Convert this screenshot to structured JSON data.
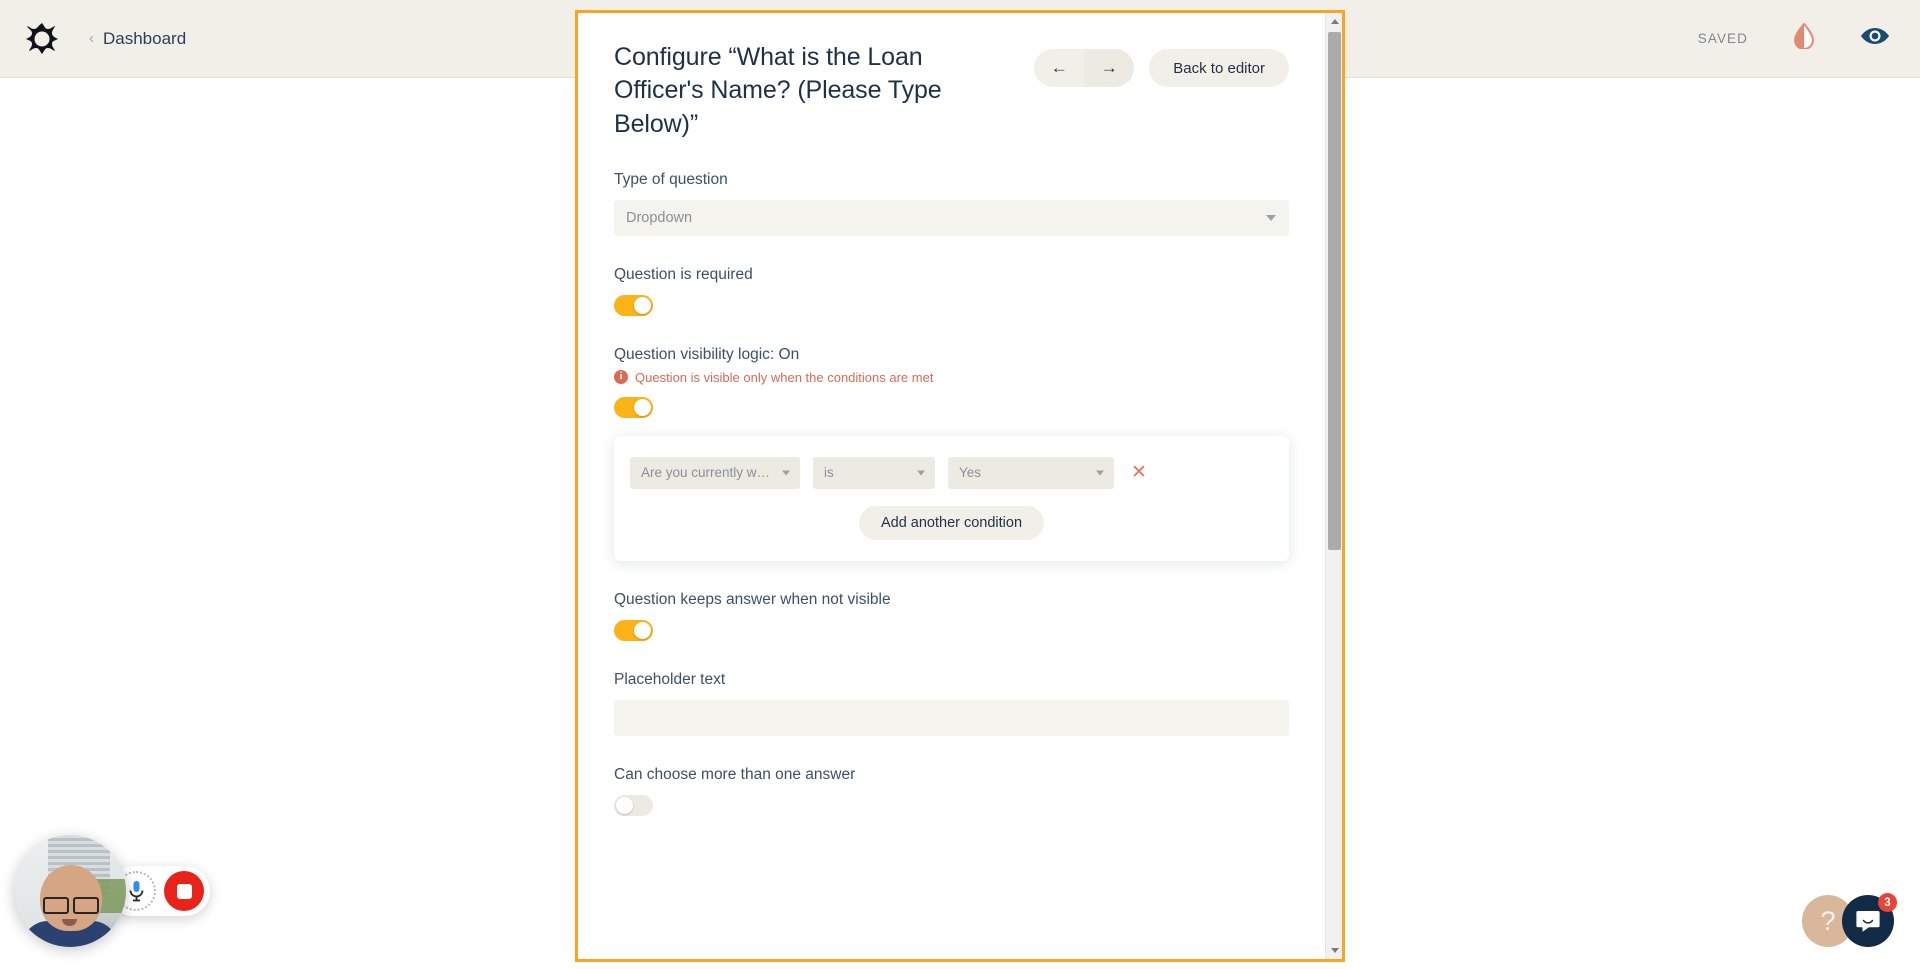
{
  "topbar": {
    "logo_icon": "flower-logo-icon",
    "breadcrumb_chevron": "‹",
    "breadcrumb_label": "Dashboard",
    "saved_label": "SAVED",
    "contrast_icon": "contrast-drop-icon",
    "preview_icon": "eye-icon",
    "background_color": "#F2EFE9"
  },
  "modal": {
    "border_color": "#F5A623",
    "title": "Configure “What is the Loan Officer's Name? (Please Type Below)”",
    "prev_label": "←",
    "next_label": "→",
    "back_to_editor_label": "Back to editor",
    "fields": {
      "type_of_question": {
        "label": "Type of question",
        "value": "Dropdown"
      },
      "question_required": {
        "label": "Question is required",
        "state": "on"
      },
      "visibility_logic": {
        "label": "Question visibility logic: On",
        "note": "Question is visible only when the conditions are met",
        "note_color": "#D96B53",
        "state": "on",
        "conditions": [
          {
            "subject": "Are you currently w…",
            "operator": "is",
            "value": "Yes",
            "delete_label": "✕"
          }
        ],
        "add_condition_label": "Add another condition"
      },
      "keeps_answer": {
        "label": "Question keeps answer when not visible",
        "state": "on"
      },
      "placeholder_text": {
        "label": "Placeholder text",
        "value": "",
        "placeholder": ""
      },
      "multi_answer": {
        "label": "Can choose more than one answer",
        "state": "off"
      }
    }
  },
  "webcam": {
    "mic_icon": "microphone-icon",
    "stop_icon": "stop-recording-icon"
  },
  "help": {
    "help_label": "?",
    "chat_icon": "chat-bubble-icon",
    "unread_count": "3",
    "badge_color": "#E8443A"
  },
  "scrollbar": {
    "up_arrow": "scroll-up-icon",
    "down_arrow": "scroll-down-icon"
  }
}
